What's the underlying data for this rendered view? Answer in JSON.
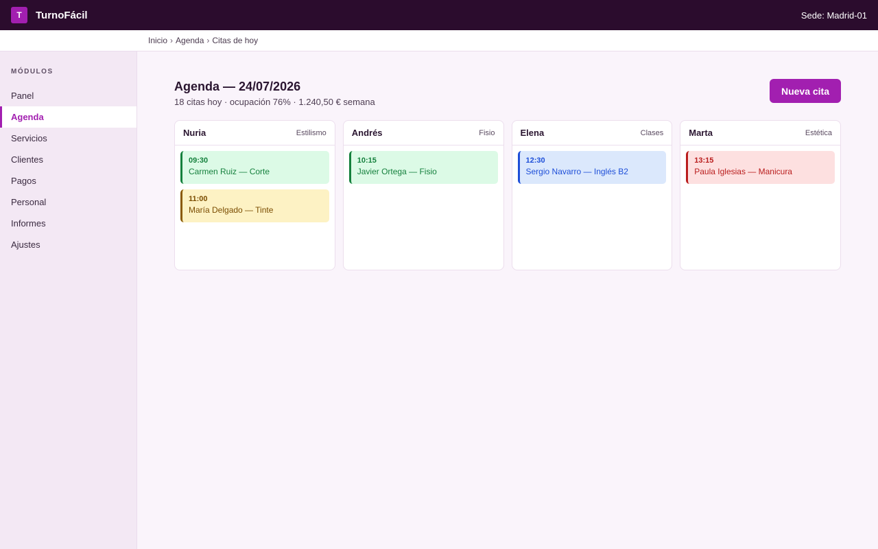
{
  "app": {
    "logo_letter": "T",
    "title": "TurnoFácil",
    "site": "Sede: Madrid-01",
    "brand_color": "#a21fb0",
    "header_bg": "#2b0c2d"
  },
  "breadcrumb": [
    "Inicio",
    "Agenda",
    "Citas de hoy"
  ],
  "sidebar": {
    "heading": "MÓDULOS",
    "items": [
      {
        "label": "Panel",
        "active": false
      },
      {
        "label": "Agenda",
        "active": true
      },
      {
        "label": "Servicios",
        "active": false
      },
      {
        "label": "Clientes",
        "active": false
      },
      {
        "label": "Pagos",
        "active": false
      },
      {
        "label": "Personal",
        "active": false
      },
      {
        "label": "Informes",
        "active": false
      },
      {
        "label": "Ajustes",
        "active": false
      }
    ]
  },
  "main": {
    "title": "Agenda — 24/07/2026",
    "subtitle": "18 citas hoy · ocupación 76% · 1.240,50 € semana",
    "new_button": "Nueva cita",
    "columns": [
      {
        "name": "Nuria",
        "role": "Estilismo",
        "appointments": [
          {
            "time": "09:30",
            "desc": "Carmen Ruiz — Corte",
            "color": "green"
          },
          {
            "time": "11:00",
            "desc": "María Delgado — Tinte",
            "color": "amber"
          }
        ]
      },
      {
        "name": "Andrés",
        "role": "Fisio",
        "appointments": [
          {
            "time": "10:15",
            "desc": "Javier Ortega — Fisio",
            "color": "green"
          }
        ]
      },
      {
        "name": "Elena",
        "role": "Clases",
        "appointments": [
          {
            "time": "12:30",
            "desc": "Sergio Navarro — Inglés B2",
            "color": "blue"
          }
        ]
      },
      {
        "name": "Marta",
        "role": "Estética",
        "appointments": [
          {
            "time": "13:15",
            "desc": "Paula Iglesias — Manicura",
            "color": "red"
          }
        ]
      }
    ]
  }
}
